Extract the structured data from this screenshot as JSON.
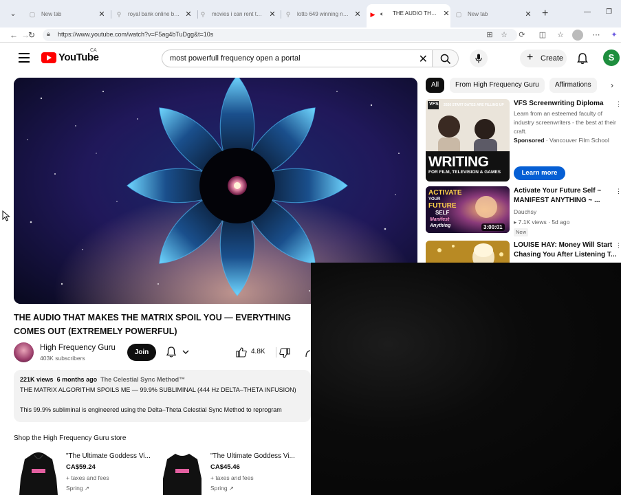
{
  "browser": {
    "tabs": [
      {
        "title": "New tab",
        "icon": "page-icon"
      },
      {
        "title": "royal bank online banking",
        "icon": "search-icon"
      },
      {
        "title": "movies i can rent that are",
        "icon": "search-icon"
      },
      {
        "title": "lotto 649 winning numbers",
        "icon": "search-icon"
      },
      {
        "title": "THE AUDIO THAT MAKES",
        "icon": "youtube-icon",
        "active": true
      },
      {
        "title": "New tab",
        "icon": "page-icon"
      }
    ],
    "url": "https://www.youtube.com/watch?v=F5ag4bTuDgg&t=10s"
  },
  "youtube": {
    "logo_text": "YouTube",
    "country_code": "CA",
    "search_query": "most powerfull frequency open a portal",
    "create_label": "Create",
    "account_initial": "S"
  },
  "video": {
    "title": "THE AUDIO THAT MAKES THE MATRIX SPOIL YOU — EVERYTHING COMES OUT (EXTREMELY POWERFUL)",
    "channel_name": "High Frequency Guru",
    "subscribers": "403K subscribers",
    "join_label": "Join",
    "likes": "4.8K",
    "views": "221K views",
    "age": "6 months ago",
    "tag": "The Celestial Sync Method™",
    "desc_line1": "THE MATRIX ALGORITHM SPOILS ME — 99.9% SUBLIMINAL (444 Hz DELTA–THETA INFUSION)",
    "desc_line2": "This 99.9% subliminal is engineered using the Delta–Theta Celestial Sync Method to reprogram"
  },
  "store": {
    "title": "Shop the High Frequency Guru store",
    "items": [
      {
        "name": "\"The Ultimate Goddess Vi...",
        "price": "CA$59.24",
        "tax": "+ taxes and fees",
        "vendor": "Spring ↗"
      },
      {
        "name": "\"The Ultimate Goddess Vi...",
        "price": "CA$45.46",
        "tax": "+ taxes and fees",
        "vendor": "Spring ↗"
      }
    ]
  },
  "chips": [
    "All",
    "From High Frequency Guru",
    "Affirmations"
  ],
  "recommendations": [
    {
      "title": "VFS Screenwriting Diploma",
      "desc": "Learn from an esteemed faculty of industry screenwriters - the best at their craft.",
      "sponsored": "Sponsored",
      "advertiser": "Vancouver Film School",
      "cta": "Learn more",
      "thumb_text": "WRITING",
      "thumb_sub": "FOR FILM, TELEVISION & GAMES",
      "thumb_top": "2026 START DATES ARE FILLING UP",
      "thumb_logo": "VFS"
    },
    {
      "title": "Activate Your Future Self ~ MANIFEST ANYTHING ~ ...",
      "channel": "Dauchsy",
      "views": "7.1K views",
      "age": "5d ago",
      "badge": "New",
      "duration": "3:00:01",
      "thumb_line1": "ACTIVATE",
      "thumb_line2": "YOUR",
      "thumb_line3": "FUTURE",
      "thumb_line4": "SELF",
      "thumb_line5": "Manifest",
      "thumb_line6": "Anything"
    },
    {
      "title": "LOUISE HAY: Money Will Start Chasing You After Listening T..."
    }
  ],
  "colors": {
    "youtube_red": "#ff0000",
    "join_bg": "#0f0f0f",
    "cta_blue": "#065fd4",
    "account_green": "#1e8e3e"
  }
}
